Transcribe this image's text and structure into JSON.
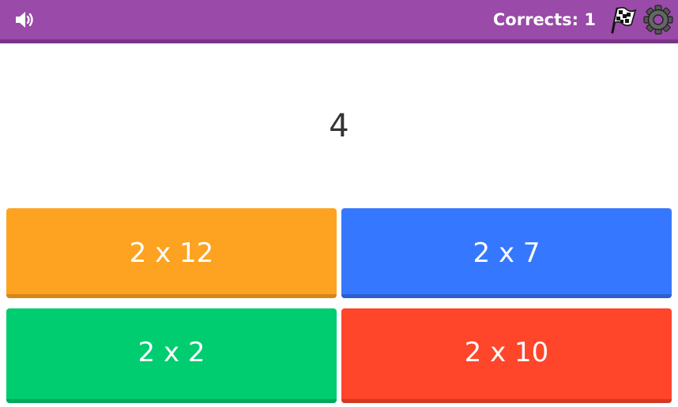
{
  "header": {
    "score_label": "Corrects: 1",
    "sound_icon": "speaker-volume-icon",
    "finish_icon": "checkered-flag-icon",
    "settings_icon": "gear-icon",
    "bar_color": "#9a4aa8"
  },
  "question": {
    "value": "4"
  },
  "answers": [
    {
      "label": "2 x 12",
      "color": "#fda321",
      "shadow": "#d6861b"
    },
    {
      "label": "2 x 7",
      "color": "#3677ff",
      "shadow": "#2b5fcf"
    },
    {
      "label": "2 x 2",
      "color": "#00cc70",
      "shadow": "#00a85c"
    },
    {
      "label": "2 x 10",
      "color": "#ff452a",
      "shadow": "#d33822"
    }
  ]
}
